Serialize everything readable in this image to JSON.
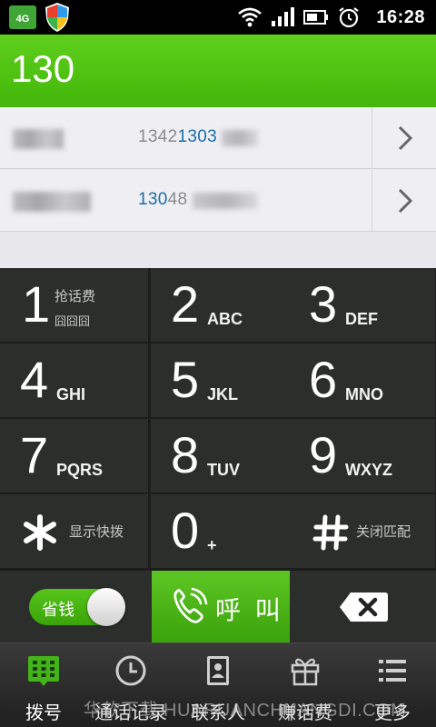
{
  "status_bar": {
    "network_badge": "4G",
    "time": "16:28",
    "icons": [
      "wifi-icon",
      "signal-icon",
      "battery-icon",
      "alarm-icon"
    ]
  },
  "dial_input": "130",
  "results": [
    {
      "number_prefix": "1342",
      "number_match": "1303",
      "number_suffix": "",
      "name_hidden": true
    },
    {
      "number_prefix": "",
      "number_match": "130",
      "number_suffix": "48",
      "name_hidden": true
    }
  ],
  "keypad": {
    "keys": [
      {
        "digit": "1",
        "sub": "抢话费",
        "sub2": "囧囧囧"
      },
      {
        "digit": "2",
        "letters": "ABC"
      },
      {
        "digit": "3",
        "letters": "DEF"
      },
      {
        "digit": "4",
        "letters": "GHI"
      },
      {
        "digit": "5",
        "letters": "JKL"
      },
      {
        "digit": "6",
        "letters": "MNO"
      },
      {
        "digit": "7",
        "letters": "PQRS"
      },
      {
        "digit": "8",
        "letters": "TUV"
      },
      {
        "digit": "9",
        "letters": "WXYZ"
      },
      {
        "symbol": "✱",
        "sub": "显示快拨"
      },
      {
        "digit": "0",
        "letters": "+"
      },
      {
        "symbol": "#",
        "sub": "关闭匹配"
      }
    ]
  },
  "actions": {
    "save_toggle_label": "省钱",
    "save_toggle_on": true,
    "call_label": "呼 叫"
  },
  "tabs": [
    {
      "label": "拨号",
      "icon": "dialpad-icon",
      "active": true
    },
    {
      "label": "通话记录",
      "icon": "clock-icon",
      "active": false
    },
    {
      "label": "联系人",
      "icon": "contacts-book-icon",
      "active": false
    },
    {
      "label": "赚话费",
      "icon": "gift-icon",
      "active": false
    },
    {
      "label": "更多",
      "icon": "list-icon",
      "active": false
    }
  ],
  "watermark": "华软下载 HUARUANCHUANGDI.COM",
  "colors": {
    "accent_green": "#4cbf12",
    "match_blue": "#1a6ea8",
    "keypad_bg": "#2c2e2c"
  }
}
